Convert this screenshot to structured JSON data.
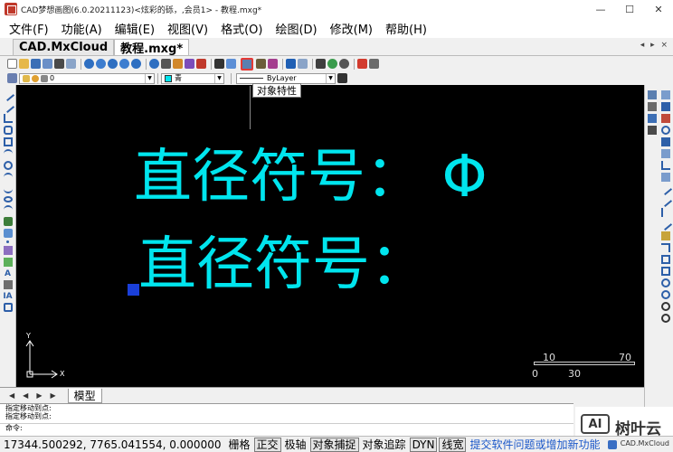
{
  "window": {
    "title": "CAD梦想画图(6.0.20211123)<炫彩的砾，,会员1> - 教程.mxg*",
    "minimize": "—",
    "maximize": "☐",
    "close": "✕"
  },
  "menu": [
    "文件(F)",
    "功能(A)",
    "编辑(E)",
    "视图(V)",
    "格式(O)",
    "绘图(D)",
    "修改(M)",
    "帮助(H)"
  ],
  "doc_tabs": [
    "CAD.MxCloud",
    "教程.mxg*"
  ],
  "tab_nav": "◂ ▸ ×",
  "toolbar": {
    "tooltip": "对象特性",
    "layer_value": "0",
    "color_value": "青",
    "linetype_value": "ByLayer"
  },
  "drawing": {
    "line1": "直径符号： Φ",
    "line2": "直径符号：",
    "axis_y": "Y",
    "axis_x": "X",
    "scale_top": [
      "10",
      "70"
    ],
    "scale_bottom": [
      "0",
      "30"
    ]
  },
  "layout_tabs": [
    "模型"
  ],
  "layout_nav": [
    "◀",
    "◀",
    "▶",
    "▶"
  ],
  "command_lines": [
    "指定移动到点:",
    "指定移动到点:",
    "命令:"
  ],
  "watermark": {
    "logo": "AI",
    "name": "树叶云"
  },
  "status": {
    "coords": "17344.500292, 7765.041554, 0.000000",
    "toggles": [
      {
        "label": "栅格",
        "on": false
      },
      {
        "label": "正交",
        "on": true
      },
      {
        "label": "极轴",
        "on": false
      },
      {
        "label": "对象捕捉",
        "on": true
      },
      {
        "label": "对象追踪",
        "on": false
      },
      {
        "label": "DYN",
        "on": true
      },
      {
        "label": "线宽",
        "on": true
      }
    ],
    "link": "提交软件问题或增加新功能",
    "brand": "CAD.MxCloud"
  },
  "colors": {
    "canvas_bg": "#000000",
    "cad_text": "#00e5ee",
    "grip": "#1a3fd9",
    "highlight_border": "#e53935",
    "link": "#1a57c9"
  }
}
